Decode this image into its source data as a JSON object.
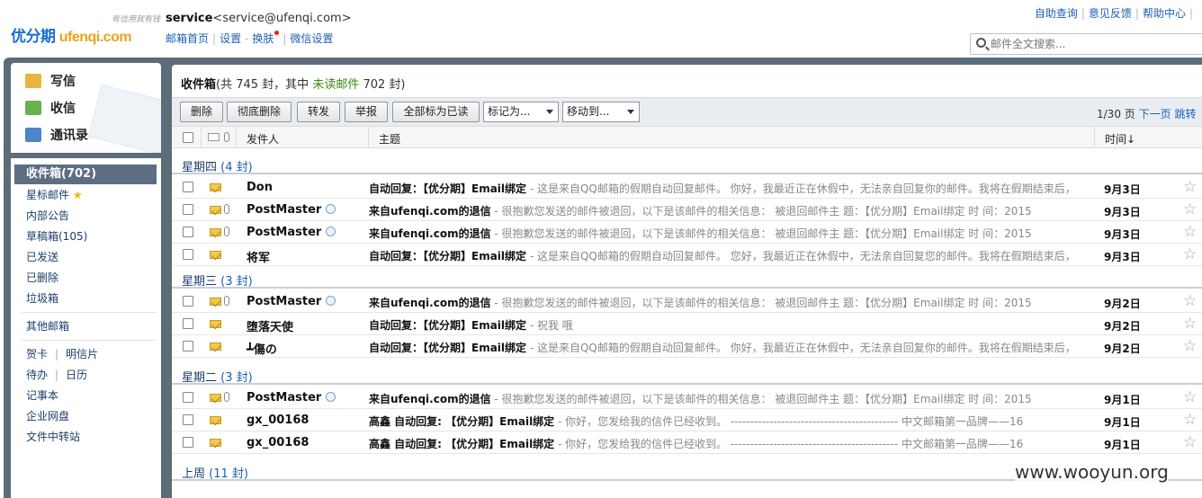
{
  "brand": {
    "logo_cn": "优分期",
    "logo_en": "ufenqi.com",
    "slogan": "有信用就有钱"
  },
  "account": {
    "name": "service",
    "email": "<service@ufenqi.com>"
  },
  "top_links": [
    "邮箱首页",
    "设置",
    "换肤",
    "微信设置"
  ],
  "right_links": [
    "自助查询",
    "意见反馈",
    "帮助中心"
  ],
  "search": {
    "placeholder": "邮件全文搜索..."
  },
  "compose": {
    "write": "写信",
    "receive": "收信",
    "contacts": "通讯录"
  },
  "nav": {
    "folders": [
      "收件箱(702)",
      "星标邮件",
      "内部公告",
      "草稿箱(105)",
      "已发送",
      "已删除",
      "垃圾箱"
    ],
    "other": "其他邮箱",
    "tools": [
      [
        "贺卡",
        "明信片"
      ],
      [
        "待办",
        "日历"
      ]
    ],
    "extra": [
      "记事本",
      "企业网盘",
      "文件中转站"
    ]
  },
  "mailbox": {
    "title": "收件箱",
    "count_text": "(共 745 封，其中 ",
    "unread_label": "未读邮件",
    "unread_text": " 702 封)"
  },
  "toolbar": {
    "delete": "删除",
    "perm_delete": "彻底删除",
    "forward": "转发",
    "report": "举报",
    "mark_all_read": "全部标为已读",
    "mark_as": "标记为...",
    "move_to": "移动到...",
    "page": "1/30 页",
    "next": "下一页",
    "jump": "跳转"
  },
  "columns": {
    "sender": "发件人",
    "subject": "主题",
    "time": "时间↓"
  },
  "groups": [
    {
      "label": "星期四",
      "count": "(4 封)",
      "rows": [
        {
          "sender": "Don",
          "qq": false,
          "clip": false,
          "subject": "自动回复：【优分期】Email绑定",
          "preview": " - 这是来自QQ邮箱的假期自动回复邮件。 你好，我最近正在休假中，无法亲自回复你的邮件。我将在假期结束后，",
          "date": "9月3日"
        },
        {
          "sender": "PostMaster",
          "qq": true,
          "clip": true,
          "subject": "来自ufenqi.com的退信",
          "preview": " - 很抱歉您发送的邮件被退回，以下是该邮件的相关信息： 被退回邮件主 题：【优分期】Email绑定 时 间：2015",
          "date": "9月3日"
        },
        {
          "sender": "PostMaster",
          "qq": true,
          "clip": true,
          "subject": "来自ufenqi.com的退信",
          "preview": " - 很抱歉您发送的邮件被退回，以下是该邮件的相关信息： 被退回邮件主 题：【优分期】Email绑定 时 间：2015",
          "date": "9月3日"
        },
        {
          "sender": "将军",
          "qq": false,
          "clip": false,
          "subject": "自动回复：【优分期】Email绑定",
          "preview": " - 这是来自QQ邮箱的假期自动回复邮件。 您好，我最近正在休假中，无法亲自回复您的邮件。我将在假期结束后，",
          "date": "9月3日"
        }
      ]
    },
    {
      "label": "星期三",
      "count": "(3 封)",
      "rows": [
        {
          "sender": "PostMaster",
          "qq": true,
          "clip": true,
          "subject": "来自ufenqi.com的退信",
          "preview": " - 很抱歉您发送的邮件被退回，以下是该邮件的相关信息： 被退回邮件主 题：【优分期】Email绑定 时 间：2015",
          "date": "9月2日"
        },
        {
          "sender": "堕落天使",
          "qq": false,
          "clip": false,
          "subject": "自动回复：【优分期】Email绑定",
          "preview": " - 祝我 哦",
          "date": "9月2日"
        },
        {
          "sender": "┻傷の",
          "qq": false,
          "clip": false,
          "subject": "自动回复：【优分期】Email绑定",
          "preview": " - 这是来自QQ邮箱的假期自动回复邮件。 你好，我最近正在休假中，无法亲自回复你的邮件。我将在假期结束后，",
          "date": "9月2日"
        }
      ]
    },
    {
      "label": "星期二",
      "count": "(3 封)",
      "rows": [
        {
          "sender": "PostMaster",
          "qq": true,
          "clip": true,
          "subject": "来自ufenqi.com的退信",
          "preview": " - 很抱歉您发送的邮件被退回，以下是该邮件的相关信息： 被退回邮件主 题：【优分期】Email绑定 时 间：2015",
          "date": "9月1日"
        },
        {
          "sender": "gx_00168",
          "qq": false,
          "clip": false,
          "subject": "高鑫 自动回复: 【优分期】Email绑定",
          "preview": " - 你好，您发给我的信件已经收到。 ------------------------------------------- 中文邮箱第一品牌——16",
          "date": "9月1日"
        },
        {
          "sender": "gx_00168",
          "qq": false,
          "clip": false,
          "subject": "高鑫 自动回复: 【优分期】Email绑定",
          "preview": " - 你好，您发给我的信件已经收到。 ------------------------------------------- 中文邮箱第一品牌——16",
          "date": "9月1日"
        }
      ]
    },
    {
      "label": "上周",
      "count": "(11 封)",
      "rows": []
    }
  ],
  "watermark": "www.wooyun.org"
}
